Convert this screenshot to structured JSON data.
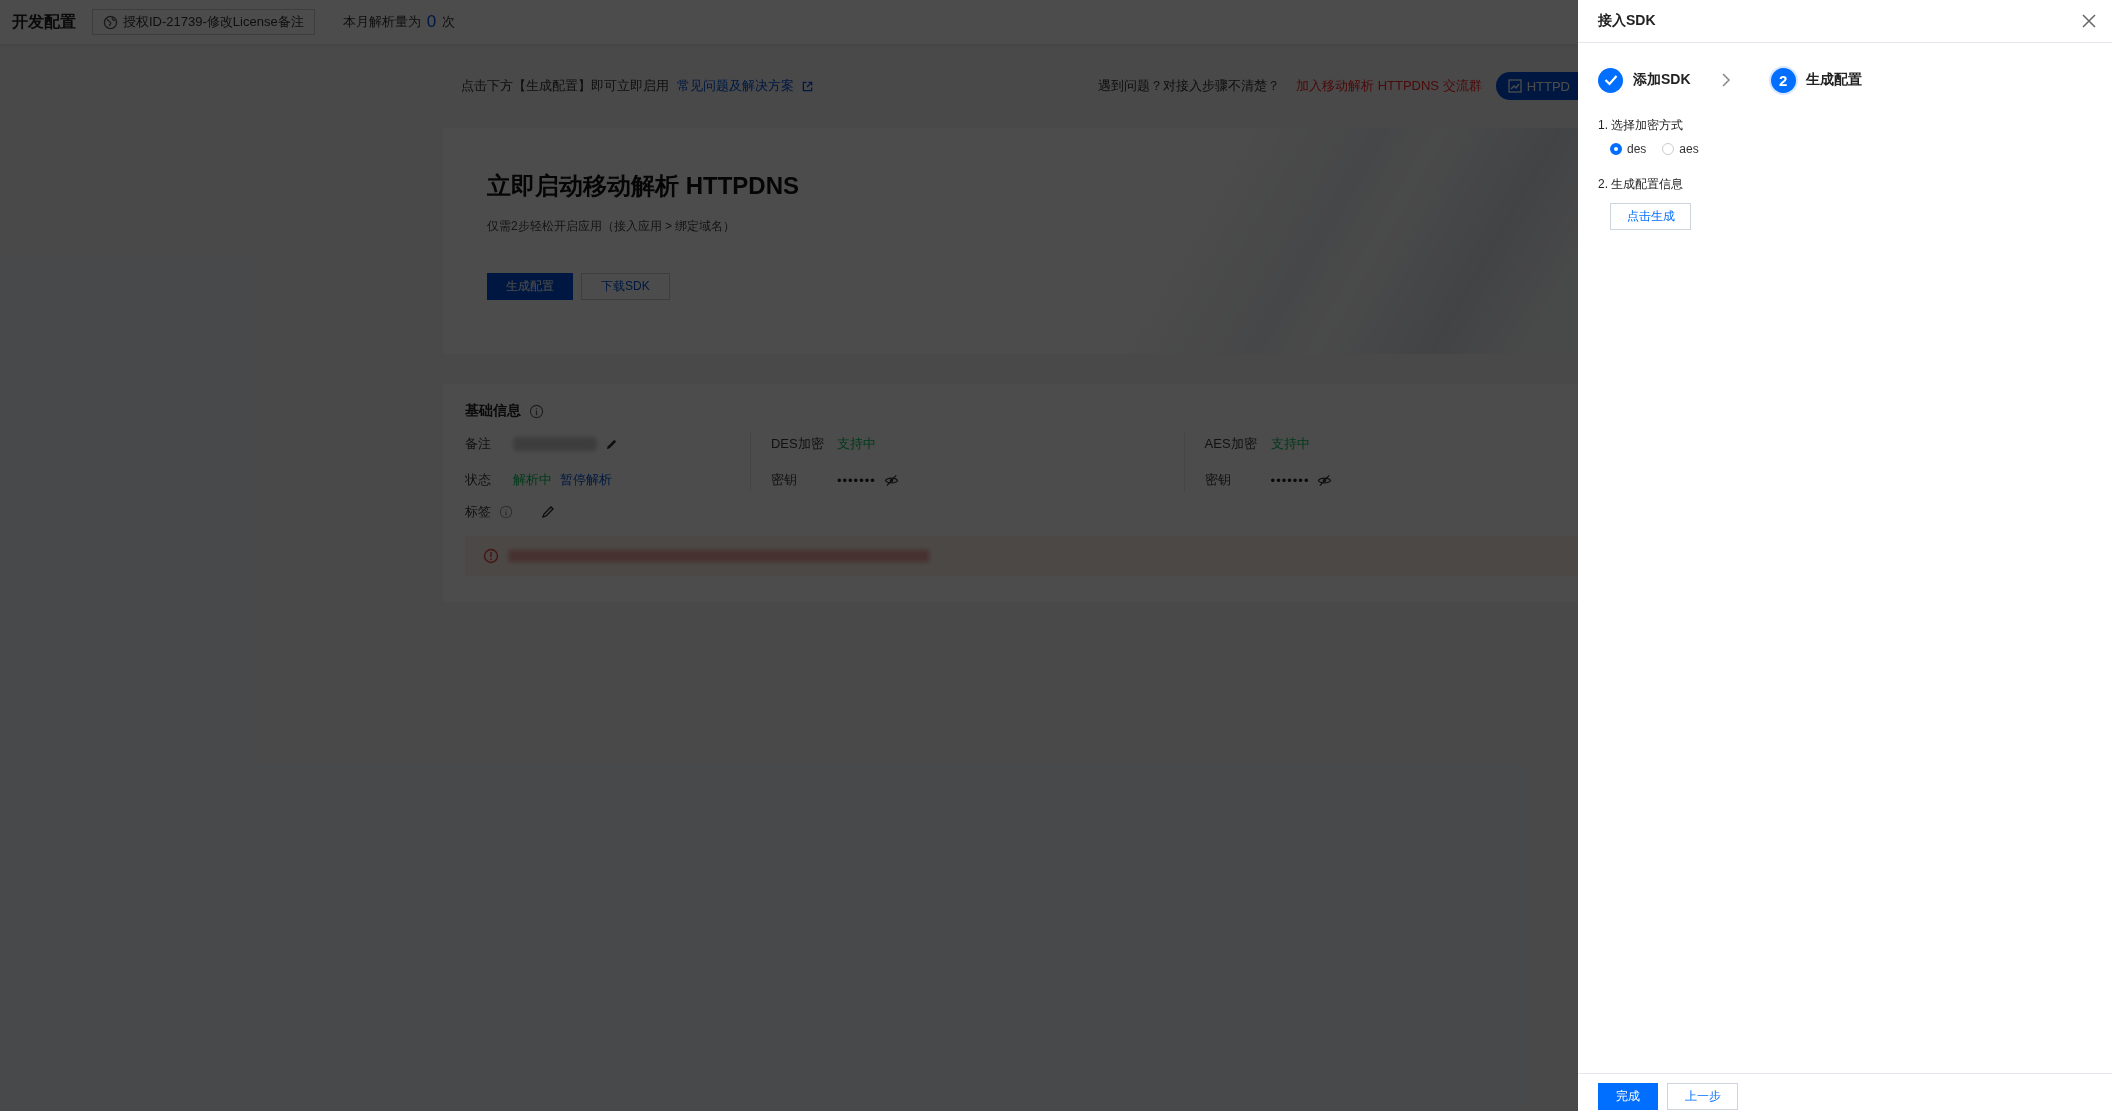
{
  "header": {
    "title": "开发配置",
    "license_chip": "授权ID-21739-修改License备注",
    "usage_label": "本月解析量为",
    "usage_count": "0",
    "usage_unit": "次"
  },
  "notice_bar": {
    "text": "点击下方【生成配置】即可立即启用",
    "faq_link": "常见问题及解决方案",
    "help_text": "遇到问题？对接入步骤不清楚？",
    "group_link": "加入移动解析 HTTPDNS 交流群",
    "cut_button": "HTTPD"
  },
  "hero": {
    "title": "立即启动移动解析 HTTPDNS",
    "subtitle": "仅需2步轻松开启应用（接入应用 > 绑定域名）",
    "buttons": [
      {
        "label": "生成配置",
        "kind": "primary"
      },
      {
        "label": "下载SDK",
        "kind": "secondary"
      }
    ]
  },
  "basic_info": {
    "title": "基础信息",
    "note_label": "备注",
    "status_label": "状态",
    "status_value": "解析中",
    "status_action": "暂停解析",
    "tags_label": "标签",
    "columns": [
      {
        "label": "DES加密",
        "status": "支持中",
        "key_label": "密钥",
        "key_value": "•••••••"
      },
      {
        "label": "AES加密",
        "status": "支持中",
        "key_label": "密钥",
        "key_value": "•••••••"
      }
    ]
  },
  "drawer": {
    "title": "接入SDK",
    "steps": [
      {
        "label": "添加SDK",
        "done": true
      },
      {
        "number": "2",
        "label": "生成配置",
        "done": false
      }
    ],
    "section_1": "1. 选择加密方式",
    "options": [
      {
        "label": "des",
        "selected": true
      },
      {
        "label": "aes",
        "selected": false
      }
    ],
    "section_2": "2. 生成配置信息",
    "generate_button": "点击生成",
    "footer_buttons": [
      {
        "label": "完成",
        "kind": "primary"
      },
      {
        "label": "上一步",
        "kind": "secondary"
      }
    ]
  }
}
